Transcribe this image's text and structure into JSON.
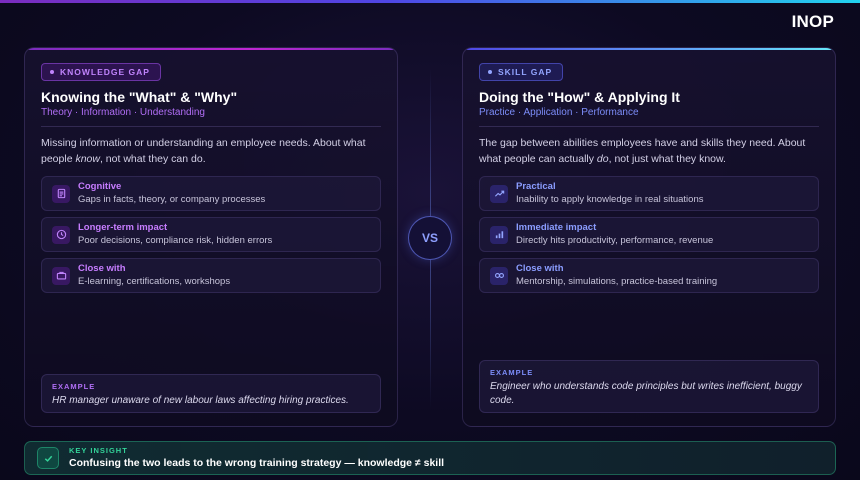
{
  "brand": "INOP",
  "left": {
    "badge": "KNOWLEDGE GAP",
    "title": "Knowing the \"What\" & \"Why\"",
    "subtitle": "Theory · Information · Understanding",
    "desc_pre": "Missing information or understanding an employee needs. About what people ",
    "desc_em": "know",
    "desc_post": ", not what they can do.",
    "items": [
      {
        "icon": "document-icon",
        "title": "Cognitive",
        "desc": "Gaps in facts, theory, or company processes"
      },
      {
        "icon": "clock-icon",
        "title": "Longer-term impact",
        "desc": "Poor decisions, compliance risk, hidden errors"
      },
      {
        "icon": "briefcase-icon",
        "title": "Close with",
        "desc": "E-learning, certifications, workshops"
      }
    ],
    "example_label": "EXAMPLE",
    "example_text": "HR manager unaware of new labour laws affecting hiring practices."
  },
  "vs": "VS",
  "right": {
    "badge": "SKILL GAP",
    "title": "Doing the \"How\" & Applying It",
    "subtitle": "Practice · Application · Performance",
    "desc_pre": "The gap between abilities employees have and skills they need. About what people can actually ",
    "desc_em": "do",
    "desc_post": ", not just what they know.",
    "items": [
      {
        "icon": "trend-up-icon",
        "title": "Practical",
        "desc": "Inability to apply knowledge in real situations"
      },
      {
        "icon": "bar-chart-icon",
        "title": "Immediate impact",
        "desc": "Directly hits productivity, performance, revenue"
      },
      {
        "icon": "infinity-icon",
        "title": "Close with",
        "desc": "Mentorship, simulations, practice-based training"
      }
    ],
    "example_label": "EXAMPLE",
    "example_text": "Engineer who understands code principles but writes inefficient, buggy code."
  },
  "insight": {
    "label": "KEY INSIGHT",
    "text": "Confusing the two leads to the wrong training strategy — knowledge ≠ skill"
  },
  "colors": {
    "knowledge_accent": "#c084fc",
    "skill_accent": "#8b9dff",
    "insight_accent": "#34d399"
  }
}
